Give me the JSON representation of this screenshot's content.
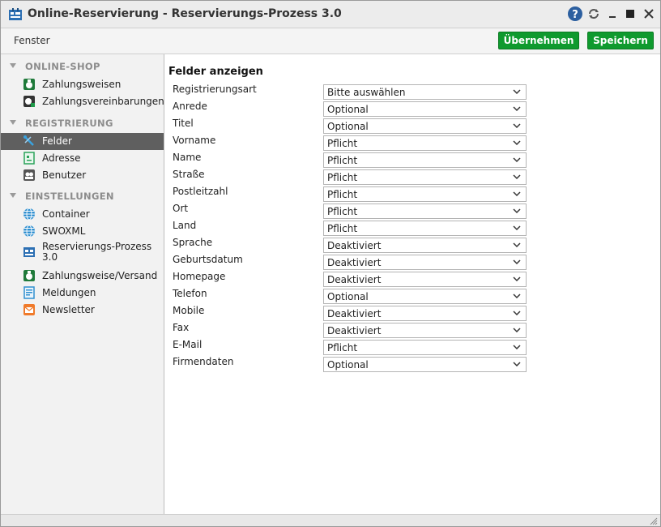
{
  "window": {
    "title": "Online-Reservierung - Reservierungs-Prozess 3.0",
    "icon": "reservation-app-icon",
    "controls": [
      "help-icon",
      "refresh-icon",
      "minimize-icon",
      "maximize-icon",
      "close-icon"
    ]
  },
  "toolbar": {
    "menu_label": "Fenster",
    "apply_label": "Übernehmen",
    "save_label": "Speichern",
    "button_color": "#0f9a2e"
  },
  "sidebar": {
    "sections": [
      {
        "title": "ONLINE-SHOP",
        "items": [
          {
            "label": "Zahlungsweisen",
            "icon": "payment-methods-icon"
          },
          {
            "label": "Zahlungsvereinbarungen",
            "icon": "payment-agreements-icon"
          }
        ]
      },
      {
        "title": "REGISTRIERUNG",
        "items": [
          {
            "label": "Felder",
            "icon": "fields-icon",
            "selected": true
          },
          {
            "label": "Adresse",
            "icon": "address-icon"
          },
          {
            "label": "Benutzer",
            "icon": "users-icon"
          }
        ]
      },
      {
        "title": "EINSTELLUNGEN",
        "items": [
          {
            "label": "Container",
            "icon": "globe-icon"
          },
          {
            "label": "SWOXML",
            "icon": "globe-icon"
          },
          {
            "label": "Reservierungs-Prozess 3.0",
            "icon": "reservation-process-icon"
          },
          {
            "label": "Zahlungsweise/Versand",
            "icon": "shipping-icon"
          },
          {
            "label": "Meldungen",
            "icon": "messages-icon"
          },
          {
            "label": "Newsletter",
            "icon": "newsletter-icon"
          }
        ]
      }
    ]
  },
  "main": {
    "heading": "Felder anzeigen",
    "fields": [
      {
        "label": "Registrierungsart",
        "value": "Bitte auswählen"
      },
      {
        "label": "Anrede",
        "value": "Optional"
      },
      {
        "label": "Titel",
        "value": "Optional"
      },
      {
        "label": "Vorname",
        "value": "Pflicht"
      },
      {
        "label": "Name",
        "value": "Pflicht"
      },
      {
        "label": "Straße",
        "value": "Pflicht"
      },
      {
        "label": "Postleitzahl",
        "value": "Pflicht"
      },
      {
        "label": "Ort",
        "value": "Pflicht"
      },
      {
        "label": "Land",
        "value": "Pflicht"
      },
      {
        "label": "Sprache",
        "value": "Deaktiviert"
      },
      {
        "label": "Geburtsdatum",
        "value": "Deaktiviert"
      },
      {
        "label": "Homepage",
        "value": "Deaktiviert"
      },
      {
        "label": "Telefon",
        "value": "Optional"
      },
      {
        "label": "Mobile",
        "value": "Deaktiviert"
      },
      {
        "label": "Fax",
        "value": "Deaktiviert"
      },
      {
        "label": "E-Mail",
        "value": "Pflicht"
      },
      {
        "label": "Firmendaten",
        "value": "Optional"
      }
    ]
  }
}
